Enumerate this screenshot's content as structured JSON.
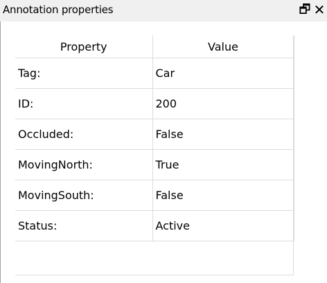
{
  "window": {
    "title": "Annotation properties",
    "float_icon": "float-window-icon",
    "close_icon": "close-icon"
  },
  "table": {
    "headers": [
      "Property",
      "Value"
    ],
    "rows": [
      {
        "property": "Tag:",
        "value": "Car"
      },
      {
        "property": "ID:",
        "value": "200"
      },
      {
        "property": "Occluded:",
        "value": "False"
      },
      {
        "property": "MovingNorth:",
        "value": "True"
      },
      {
        "property": "MovingSouth:",
        "value": "False"
      },
      {
        "property": "Status:",
        "value": "Active"
      }
    ]
  }
}
